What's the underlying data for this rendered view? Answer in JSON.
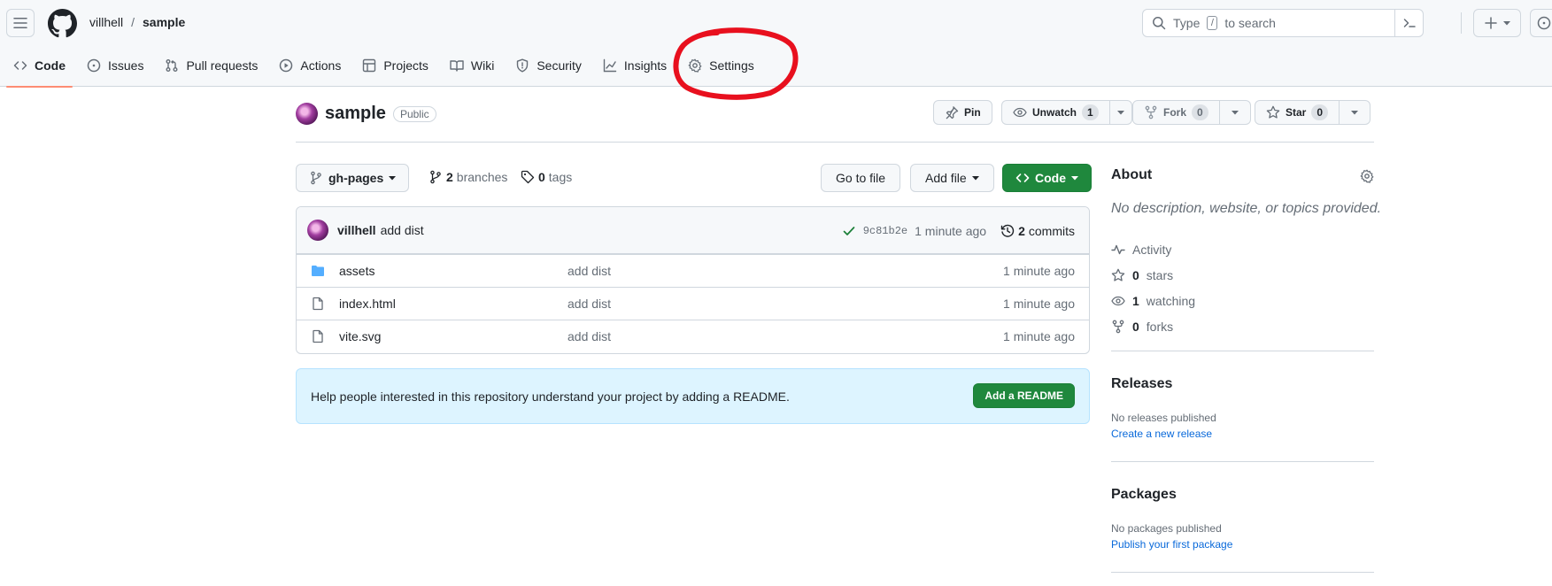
{
  "header": {
    "owner": "villhell",
    "separator": "/",
    "repo": "sample",
    "search_prefix": "Type",
    "search_key": "/",
    "search_suffix": "to search"
  },
  "tabs": [
    {
      "label": "Code",
      "icon": "code-icon",
      "active": true
    },
    {
      "label": "Issues",
      "icon": "issue-opened-icon"
    },
    {
      "label": "Pull requests",
      "icon": "git-pull-request-icon"
    },
    {
      "label": "Actions",
      "icon": "play-icon"
    },
    {
      "label": "Projects",
      "icon": "table-icon"
    },
    {
      "label": "Wiki",
      "icon": "book-icon"
    },
    {
      "label": "Security",
      "icon": "shield-icon"
    },
    {
      "label": "Insights",
      "icon": "graph-icon"
    },
    {
      "label": "Settings",
      "icon": "gear-icon"
    }
  ],
  "repo": {
    "name": "sample",
    "visibility": "Public",
    "pin_label": "Pin",
    "unwatch_label": "Unwatch",
    "watch_count": "1",
    "fork_label": "Fork",
    "fork_count": "0",
    "star_label": "Star",
    "star_count": "0"
  },
  "branch": {
    "name": "gh-pages",
    "branches_count": "2",
    "branches_label": "branches",
    "tags_count": "0",
    "tags_label": "tags",
    "go_to_file": "Go to file",
    "add_file": "Add file",
    "code": "Code"
  },
  "commit": {
    "author": "villhell",
    "message": "add dist",
    "sha": "9c81b2e",
    "age": "1 minute ago",
    "commits_count": "2",
    "commits_label": "commits"
  },
  "files": [
    {
      "name": "assets",
      "type": "folder",
      "message": "add dist",
      "age": "1 minute ago"
    },
    {
      "name": "index.html",
      "type": "file",
      "message": "add dist",
      "age": "1 minute ago"
    },
    {
      "name": "vite.svg",
      "type": "file",
      "message": "add dist",
      "age": "1 minute ago"
    }
  ],
  "readme": {
    "text": "Help people interested in this repository understand your project by adding a README.",
    "button": "Add a README"
  },
  "about": {
    "title": "About",
    "description": "No description, website, or topics provided.",
    "activity": "Activity",
    "stars_count": "0",
    "stars_label": "stars",
    "watching_count": "1",
    "watching_label": "watching",
    "forks_count": "0",
    "forks_label": "forks"
  },
  "releases": {
    "title": "Releases",
    "none": "No releases published",
    "link": "Create a new release"
  },
  "packages": {
    "title": "Packages",
    "none": "No packages published",
    "link": "Publish your first package"
  },
  "colors": {
    "accent_green": "#1f883d",
    "tab_underline": "#fd8c73",
    "annotation_red": "#e8101e",
    "link_blue": "#0969da",
    "folder_blue": "#54aeff"
  }
}
